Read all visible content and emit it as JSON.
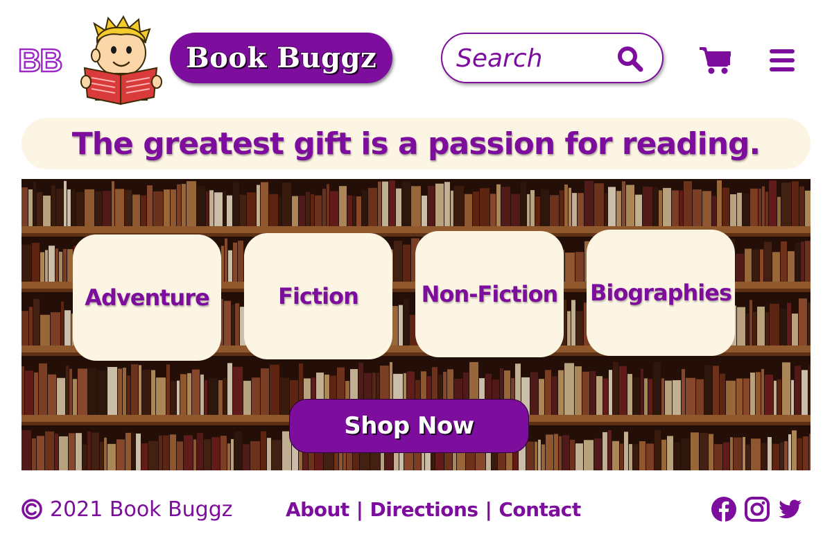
{
  "header": {
    "logo_initials": "BB",
    "brand_name": "Book Buggz",
    "search": {
      "placeholder": "Search",
      "value": ""
    },
    "icons": {
      "search": "search-icon",
      "cart": "cart-icon",
      "menu": "hamburger-menu-icon"
    }
  },
  "tagline": "The greatest gift is a passion for reading.",
  "hero": {
    "background": "bookshelf-photo",
    "categories": [
      {
        "label": "Adventure"
      },
      {
        "label": "Fiction"
      },
      {
        "label": "Non-Fiction"
      },
      {
        "label": "Biographies"
      }
    ],
    "cta_label": "Shop Now"
  },
  "footer": {
    "copyright": "2021 Book Buggz",
    "links": [
      "About",
      "Directions",
      "Contact"
    ],
    "separator": "|",
    "social": [
      "facebook-icon",
      "instagram-icon",
      "twitter-icon"
    ]
  },
  "colors": {
    "brand_purple": "#7d0d9c",
    "cream": "#fdf5e4",
    "white": "#ffffff"
  }
}
